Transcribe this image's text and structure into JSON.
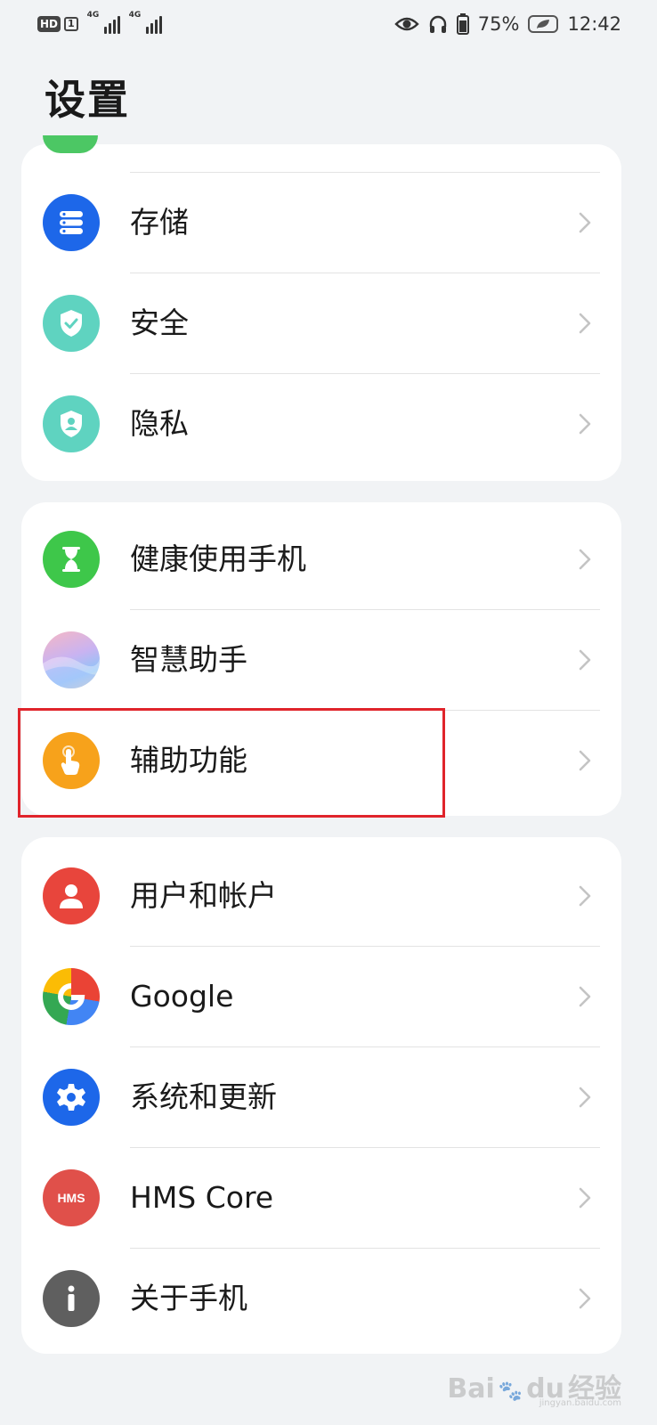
{
  "status_bar": {
    "hd": "HD",
    "sim": "1",
    "network_1": "4G",
    "network_2": "4G",
    "battery": "75%",
    "time": "12:42"
  },
  "page": {
    "title": "设置"
  },
  "groups": [
    {
      "items": [
        {
          "label": "存储",
          "icon": "storage-icon",
          "color": "#1d67e9"
        },
        {
          "label": "安全",
          "icon": "shield-check-icon",
          "color": "#5fd3c0"
        },
        {
          "label": "隐私",
          "icon": "privacy-shield-icon",
          "color": "#5fd3c0"
        }
      ]
    },
    {
      "items": [
        {
          "label": "健康使用手机",
          "icon": "hourglass-icon",
          "color": "#3ec74a"
        },
        {
          "label": "智慧助手",
          "icon": "assistant-orb-icon",
          "color": "#b8a6f0"
        },
        {
          "label": "辅助功能",
          "icon": "hand-touch-icon",
          "color": "#f7a21b"
        }
      ]
    },
    {
      "items": [
        {
          "label": "用户和帐户",
          "icon": "user-icon",
          "color": "#e8453c"
        },
        {
          "label": "Google",
          "icon": "google-icon",
          "color": "#4285f4"
        },
        {
          "label": "系统和更新",
          "icon": "gear-icon",
          "color": "#1d67e9"
        },
        {
          "label": "HMS Core",
          "icon": "hms-icon",
          "color": "#e0504a"
        },
        {
          "label": "关于手机",
          "icon": "info-icon",
          "color": "#5f5f5f"
        }
      ]
    }
  ],
  "annotation": {
    "highlight_color": "#e0242b"
  },
  "watermark": {
    "brand": "Bai",
    "mark": "du",
    "suffix": "经验",
    "url": "jingyan.baidu.com"
  }
}
